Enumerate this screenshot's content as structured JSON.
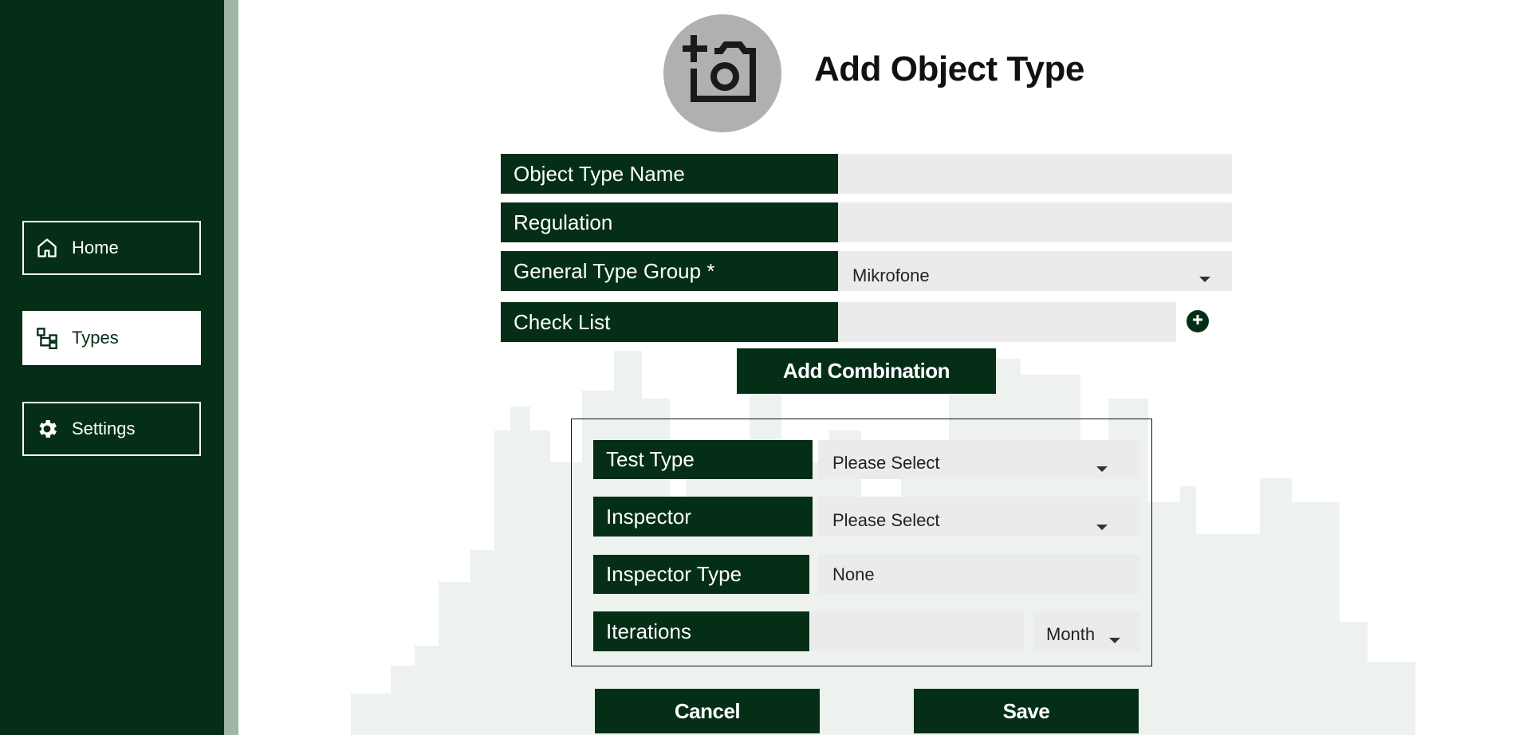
{
  "sidebar": {
    "items": [
      {
        "label": "Home",
        "icon": "home-icon",
        "active": false
      },
      {
        "label": "Types",
        "icon": "hierarchy-icon",
        "active": true
      },
      {
        "label": "Settings",
        "icon": "gear-icon",
        "active": false
      }
    ]
  },
  "header": {
    "title": "Add Object Type",
    "avatar_icon": "add-photo-icon"
  },
  "form": {
    "object_type_name": {
      "label": "Object Type Name",
      "value": ""
    },
    "regulation": {
      "label": "Regulation",
      "value": ""
    },
    "general_type_group": {
      "label": "General Type Group *",
      "value": "Mikrofone"
    },
    "check_list": {
      "label": "Check List",
      "value": ""
    },
    "add_combination_label": "Add Combination"
  },
  "combination": {
    "test_type": {
      "label": "Test Type",
      "value": "Please Select"
    },
    "inspector": {
      "label": "Inspector",
      "value": "Please Select"
    },
    "inspector_type": {
      "label": "Inspector Type",
      "value": "None"
    },
    "iterations": {
      "label": "Iterations",
      "value": "",
      "unit": "Month"
    }
  },
  "actions": {
    "cancel_label": "Cancel",
    "save_label": "Save"
  },
  "colors": {
    "primary": "#052e17",
    "field_bg": "#ebebeb",
    "sidebar_edge": "#9fb5a5"
  }
}
